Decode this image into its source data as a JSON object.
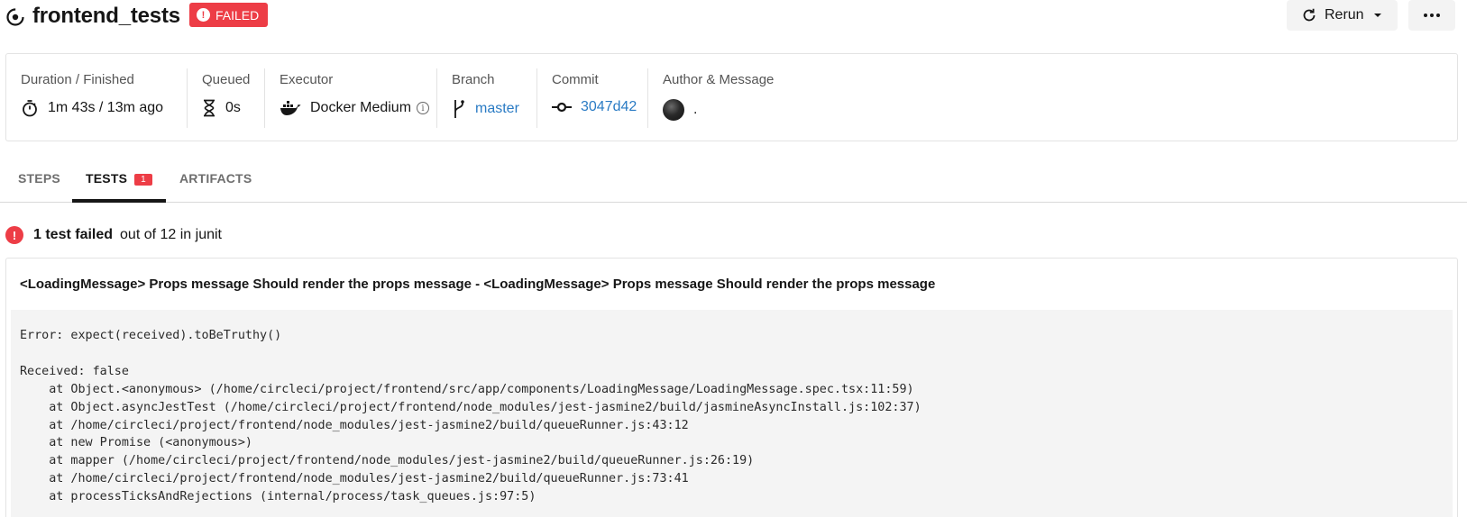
{
  "header": {
    "title": "frontend_tests",
    "status_badge": "FAILED",
    "rerun_label": "Rerun",
    "more_label": "•••"
  },
  "meta": {
    "duration": {
      "label": "Duration / Finished",
      "value": "1m 43s / 13m ago"
    },
    "queued": {
      "label": "Queued",
      "value": "0s"
    },
    "executor": {
      "label": "Executor",
      "value": "Docker Medium"
    },
    "branch": {
      "label": "Branch",
      "value": "master"
    },
    "commit": {
      "label": "Commit",
      "value": "3047d42"
    },
    "author": {
      "label": "Author & Message",
      "value": "."
    }
  },
  "tabs": [
    {
      "label": "STEPS"
    },
    {
      "label": "TESTS",
      "count": "1"
    },
    {
      "label": "ARTIFACTS"
    }
  ],
  "summary": {
    "failed": "1 test failed",
    "rest": "out of 12 in junit"
  },
  "test": {
    "title": "<LoadingMessage> Props message Should render the props message - <LoadingMessage> Props message Should render the props message",
    "error": "Error: expect(received).toBeTruthy()\n\nReceived: false\n    at Object.<anonymous> (/home/circleci/project/frontend/src/app/components/LoadingMessage/LoadingMessage.spec.tsx:11:59)\n    at Object.asyncJestTest (/home/circleci/project/frontend/node_modules/jest-jasmine2/build/jasmineAsyncInstall.js:102:37)\n    at /home/circleci/project/frontend/node_modules/jest-jasmine2/build/queueRunner.js:43:12\n    at new Promise (<anonymous>)\n    at mapper (/home/circleci/project/frontend/node_modules/jest-jasmine2/build/queueRunner.js:26:19)\n    at /home/circleci/project/frontend/node_modules/jest-jasmine2/build/queueRunner.js:73:41\n    at processTicksAndRejections (internal/process/task_queues.js:97:5)"
  },
  "colors": {
    "failed_red": "#ed3d46",
    "link_blue": "#2a7bc4",
    "error_bg": "#f4f4f4"
  }
}
